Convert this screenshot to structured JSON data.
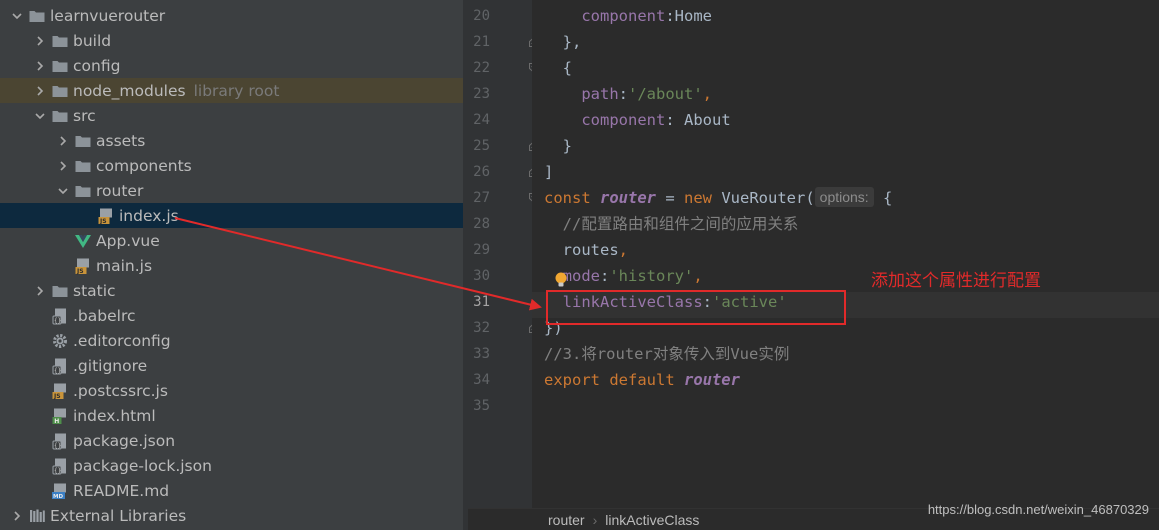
{
  "project_tree": {
    "items": [
      {
        "label": "learnvuerouter",
        "type": "folder",
        "state": "expanded"
      },
      {
        "label": "build",
        "type": "folder",
        "state": "collapsed"
      },
      {
        "label": "config",
        "type": "folder",
        "state": "collapsed"
      },
      {
        "label": "node_modules",
        "type": "folder-excluded",
        "state": "collapsed",
        "hint": "library root"
      },
      {
        "label": "src",
        "type": "folder",
        "state": "expanded"
      },
      {
        "label": "assets",
        "type": "folder",
        "state": "collapsed"
      },
      {
        "label": "components",
        "type": "folder",
        "state": "collapsed"
      },
      {
        "label": "router",
        "type": "folder",
        "state": "expanded"
      },
      {
        "label": "index.js",
        "type": "js-file",
        "selected": true
      },
      {
        "label": "App.vue",
        "type": "vue-file"
      },
      {
        "label": "main.js",
        "type": "js-file"
      },
      {
        "label": "static",
        "type": "folder",
        "state": "collapsed"
      },
      {
        "label": ".babelrc",
        "type": "config-file"
      },
      {
        "label": ".editorconfig",
        "type": "gear-file"
      },
      {
        "label": ".gitignore",
        "type": "config-file"
      },
      {
        "label": ".postcssrc.js",
        "type": "js-file"
      },
      {
        "label": "index.html",
        "type": "html-file"
      },
      {
        "label": "package.json",
        "type": "config-file"
      },
      {
        "label": "package-lock.json",
        "type": "config-file"
      },
      {
        "label": "README.md",
        "type": "md-file"
      },
      {
        "label": "External Libraries",
        "type": "library",
        "state": "collapsed"
      }
    ]
  },
  "editor": {
    "current_line": "31",
    "lines": [
      {
        "n": "20",
        "tokens": [
          {
            "t": "    "
          },
          {
            "t": "component",
            "c": "prop"
          },
          {
            "t": ":Home"
          }
        ]
      },
      {
        "n": "21",
        "tokens": [
          {
            "t": "  },",
            "c": "plain"
          }
        ]
      },
      {
        "n": "22",
        "tokens": [
          {
            "t": "  {"
          }
        ]
      },
      {
        "n": "23",
        "tokens": [
          {
            "t": "    "
          },
          {
            "t": "path",
            "c": "prop"
          },
          {
            "t": ":"
          },
          {
            "t": "'/about'",
            "c": "str"
          },
          {
            "t": ",",
            "c": "kw"
          }
        ]
      },
      {
        "n": "24",
        "tokens": [
          {
            "t": "    "
          },
          {
            "t": "component",
            "c": "prop"
          },
          {
            "t": ": About"
          }
        ]
      },
      {
        "n": "25",
        "tokens": [
          {
            "t": "  }"
          }
        ]
      },
      {
        "n": "26",
        "tokens": [
          {
            "t": "]"
          }
        ]
      },
      {
        "n": "27",
        "tokens": [
          {
            "t": "const ",
            "c": "kw"
          },
          {
            "t": "router",
            "c": "var"
          },
          {
            "t": " = "
          },
          {
            "t": "new ",
            "c": "kw"
          },
          {
            "t": "VueRouter("
          },
          {
            "hint": "options:"
          },
          {
            "t": " {"
          }
        ]
      },
      {
        "n": "28",
        "tokens": [
          {
            "t": "  "
          },
          {
            "t": "//配置路由和组件之间的应用关系",
            "c": "cmt"
          }
        ]
      },
      {
        "n": "29",
        "tokens": [
          {
            "t": "  routes"
          },
          {
            "t": ",",
            "c": "kw"
          }
        ]
      },
      {
        "n": "30",
        "tokens": [
          {
            "t": "  "
          },
          {
            "t": "mode",
            "c": "prop"
          },
          {
            "t": ":"
          },
          {
            "t": "'history'",
            "c": "str"
          },
          {
            "t": ",",
            "c": "kw"
          }
        ]
      },
      {
        "n": "31",
        "tokens": [
          {
            "t": "  "
          },
          {
            "t": "linkActiveClass",
            "c": "prop"
          },
          {
            "t": ":"
          },
          {
            "t": "'active'",
            "c": "str"
          }
        ]
      },
      {
        "n": "32",
        "tokens": [
          {
            "t": "})"
          }
        ]
      },
      {
        "n": "33",
        "tokens": [
          {
            "t": "//3.将router对象传入到Vue实例",
            "c": "cmt"
          }
        ]
      },
      {
        "n": "34",
        "tokens": [
          {
            "t": "export ",
            "c": "kw"
          },
          {
            "t": "default ",
            "c": "kw"
          },
          {
            "t": "router",
            "c": "var"
          }
        ]
      },
      {
        "n": "35",
        "tokens": []
      }
    ]
  },
  "breadcrumb": {
    "items": [
      "router",
      "linkActiveClass"
    ]
  },
  "annotation": {
    "text": "添加这个属性进行配置"
  },
  "watermark": "https://blog.csdn.net/weixin_46870329",
  "colors": {
    "keyword": "#cc7832",
    "property": "#9876aa",
    "string": "#6a8759",
    "comment": "#808080",
    "annotation": "#e12a2a",
    "selection": "#0d293e"
  },
  "icons": {
    "folder": "folder-icon",
    "js": "js-file-icon",
    "vue": "vue-icon",
    "html": "html-file-icon",
    "md": "markdown-file-icon",
    "json": "config-file-icon",
    "gear": "gear-icon",
    "bulb": "lightbulb-icon"
  }
}
